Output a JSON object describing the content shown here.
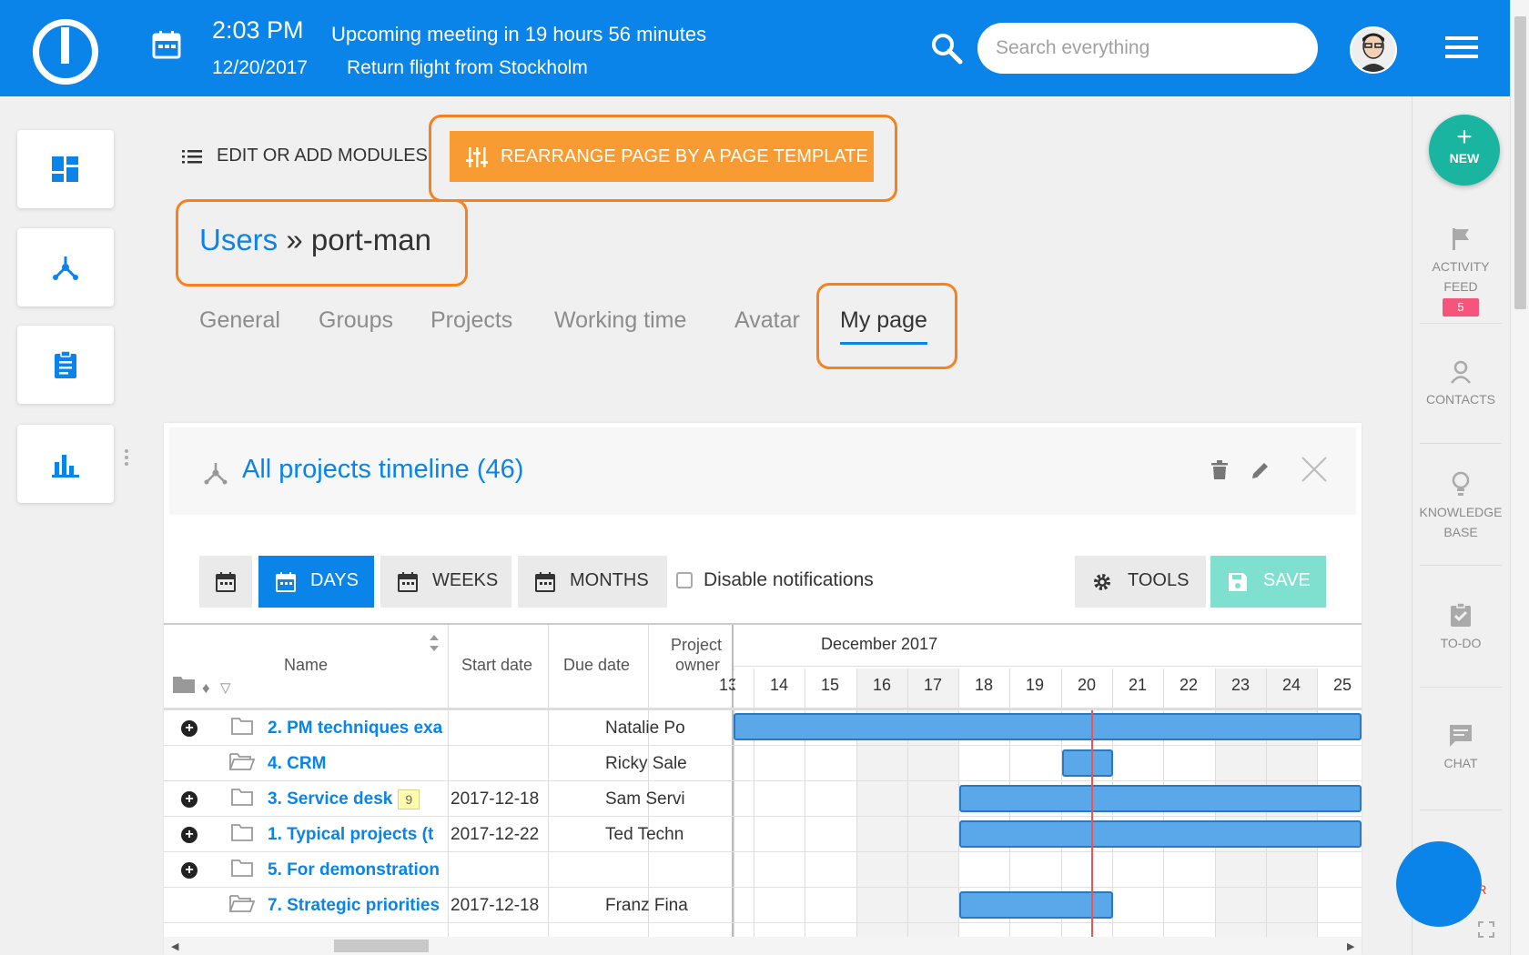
{
  "topbar": {
    "time": "2:03 PM",
    "meeting": "Upcoming meeting in 19 hours 56 minutes",
    "date": "12/20/2017",
    "flight": "Return flight from Stockholm",
    "search_placeholder": "Search everything",
    "accent": "#0a84e8"
  },
  "toolbar": {
    "edit_modules": "EDIT OR ADD MODULES",
    "rearrange": "REARRANGE PAGE BY A PAGE TEMPLATE"
  },
  "breadcrumb": {
    "parent": "Users",
    "sep": " » ",
    "current": "port-man"
  },
  "tabs": [
    "General",
    "Groups",
    "Projects",
    "Working time",
    "Avatar",
    "My page"
  ],
  "module": {
    "title": "All projects timeline (46)",
    "days": "DAYS",
    "weeks": "WEEKS",
    "months": "MONTHS",
    "disable_notifications": "Disable notifications",
    "tools": "TOOLS",
    "save": "SAVE"
  },
  "gantt": {
    "columns": {
      "name": "Name",
      "start": "Start date",
      "due": "Due date",
      "owner_line1": "Project",
      "owner_line2": "owner"
    },
    "month": "December 2017",
    "days": [
      "13",
      "14",
      "15",
      "16",
      "17",
      "18",
      "19",
      "20",
      "21",
      "22",
      "23",
      "24",
      "25"
    ],
    "rows": [
      {
        "name": "2. PM techniques exa",
        "start": "",
        "owner": "Natalie Po",
        "badge": ""
      },
      {
        "name": "4. CRM",
        "start": "",
        "owner": "Ricky Sale",
        "badge": ""
      },
      {
        "name": "3. Service desk",
        "start": "2017-12-18",
        "owner": "Sam Servi",
        "badge": "9"
      },
      {
        "name": "1. Typical projects (t",
        "start": "2017-12-22",
        "owner": "Ted Techn",
        "badge": ""
      },
      {
        "name": "5. For demonstration",
        "start": "",
        "owner": "",
        "badge": ""
      },
      {
        "name": "7. Strategic priorities",
        "start": "2017-12-18",
        "owner": "Franz Fina",
        "badge": ""
      }
    ]
  },
  "right_sidebar": {
    "new": "NEW",
    "activity_1": "ACTIVITY",
    "activity_2": "FEED",
    "activity_badge": "5",
    "contacts": "CONTACTS",
    "kb_1": "KNOWLEDGE",
    "kb_2": "BASE",
    "todo": "TO-DO",
    "chat": "CHAT",
    "timer": "ER"
  }
}
